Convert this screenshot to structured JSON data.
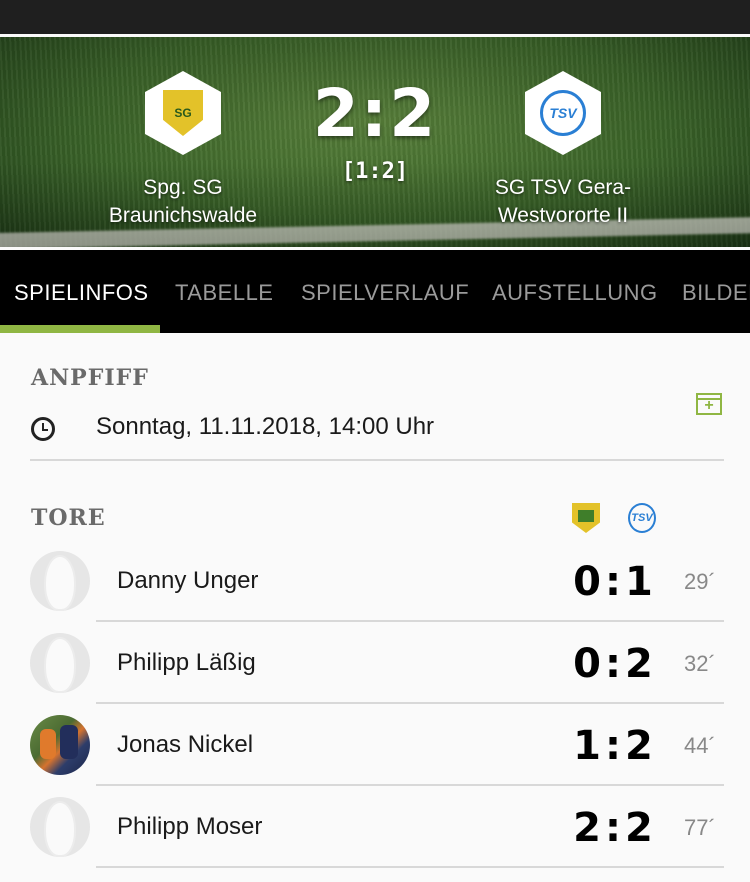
{
  "match": {
    "home_team": "Spg. SG Braunichswalde",
    "home_team_line1": "Spg. SG",
    "home_team_line2": "Braunichswalde",
    "home_crest_text": "SG",
    "away_team": "SG TSV Gera-Westvororte II",
    "away_team_line1": "SG TSV Gera-",
    "away_team_line2": "Westvororte II",
    "away_crest_text": "TSV",
    "score": "2:2",
    "halftime": "[1:2]"
  },
  "tabs": [
    {
      "label": "SPIELINFOS",
      "active": true
    },
    {
      "label": "TABELLE",
      "active": false
    },
    {
      "label": "SPIELVERLAUF",
      "active": false
    },
    {
      "label": "AUFSTELLUNG",
      "active": false
    },
    {
      "label": "BILDER",
      "active": false
    }
  ],
  "kickoff": {
    "title": "ANPFIFF",
    "datetime": "Sonntag, 11.11.2018, 14:00 Uhr",
    "calendar_icon": "calendar-add-icon",
    "clock_icon": "clock-icon"
  },
  "goals": {
    "title": "TORE",
    "items": [
      {
        "player": "Danny Unger",
        "score": "0:1",
        "minute": "29´",
        "avatar": "placeholder"
      },
      {
        "player": "Philipp Läßig",
        "score": "0:2",
        "minute": "32´",
        "avatar": "placeholder"
      },
      {
        "player": "Jonas Nickel",
        "score": "1:2",
        "minute": "44´",
        "avatar": "photo"
      },
      {
        "player": "Philipp Moser",
        "score": "2:2",
        "minute": "77´",
        "avatar": "placeholder"
      }
    ]
  },
  "colors": {
    "accent": "#8fb643",
    "tab_bar": "#000000",
    "status_bar": "#1f1f1f"
  }
}
